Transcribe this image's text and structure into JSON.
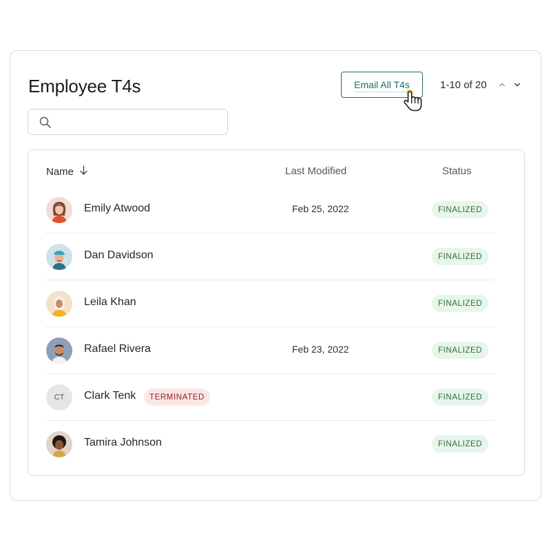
{
  "page": {
    "title": "Employee T4s",
    "email_button_label": "Email All T4s",
    "pagination": "1-10 of 20"
  },
  "search": {
    "placeholder": "",
    "value": ""
  },
  "table": {
    "columns": {
      "name": "Name",
      "last_modified": "Last Modified",
      "status": "Status"
    },
    "rows": [
      {
        "name": "Emily Atwood",
        "last_modified": "Feb 25, 2022",
        "status": "FINALIZED",
        "avatar": "avatar-woman-brown-hair",
        "tag": "",
        "initials": ""
      },
      {
        "name": "Dan Davidson",
        "last_modified": "",
        "status": "FINALIZED",
        "avatar": "avatar-man-blue-cap",
        "tag": "",
        "initials": ""
      },
      {
        "name": "Leila Khan",
        "last_modified": "",
        "status": "FINALIZED",
        "avatar": "avatar-woman-hijab",
        "tag": "",
        "initials": ""
      },
      {
        "name": "Rafael Rivera",
        "last_modified": "Feb 23, 2022",
        "status": "FINALIZED",
        "avatar": "avatar-man-beard",
        "tag": "",
        "initials": ""
      },
      {
        "name": "Clark Tenk",
        "last_modified": "",
        "status": "FINALIZED",
        "avatar": "avatar-initials",
        "tag": "TERMINATED",
        "initials": "CT"
      },
      {
        "name": "Tamira Johnson",
        "last_modified": "",
        "status": "FINALIZED",
        "avatar": "avatar-woman-curly-hair",
        "tag": "",
        "initials": ""
      }
    ]
  },
  "icons": {
    "search": "search-icon",
    "sort": "arrow-down-icon",
    "page_up": "chevron-up-icon",
    "page_down": "chevron-down-icon",
    "cursor": "hand-pointer-icon"
  },
  "colors": {
    "accent": "#1d6f6b",
    "finalized_bg": "#e7f5ea",
    "finalized_text": "#2e6b3f",
    "terminated_bg": "#fbe6e6",
    "terminated_text": "#8a2020"
  }
}
